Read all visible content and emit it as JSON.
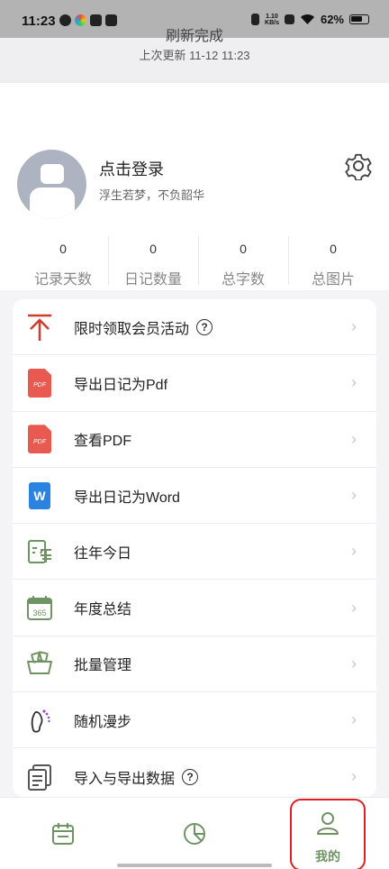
{
  "status_bar": {
    "time": "11:23",
    "speed_value": "1.10",
    "speed_unit": "KB/s",
    "battery": "62%"
  },
  "refresh": {
    "title": "刷新完成",
    "subtitle": "上次更新 11-12 11:23"
  },
  "profile": {
    "login_label": "点击登录",
    "motto": "浮生若梦，不负韶华"
  },
  "stats": [
    {
      "value": "0",
      "label": "记录天数"
    },
    {
      "value": "0",
      "label": "日记数量"
    },
    {
      "value": "0",
      "label": "总字数"
    },
    {
      "value": "0",
      "label": "总图片"
    }
  ],
  "menu": {
    "items": [
      {
        "label": "限时领取会员活动",
        "icon": "arrow-up-icon",
        "help": true
      },
      {
        "label": "导出日记为Pdf",
        "icon": "pdf-icon",
        "help": false
      },
      {
        "label": "查看PDF",
        "icon": "pdf-icon",
        "help": false
      },
      {
        "label": "导出日记为Word",
        "icon": "word-icon",
        "help": false
      },
      {
        "label": "往年今日",
        "icon": "calendar-year-icon",
        "help": false
      },
      {
        "label": "年度总结",
        "icon": "calendar-365-icon",
        "help": false
      },
      {
        "label": "批量管理",
        "icon": "basket-icon",
        "help": false
      },
      {
        "label": "随机漫步",
        "icon": "footprint-icon",
        "help": false
      },
      {
        "label": "导入与导出数据",
        "icon": "documents-icon",
        "help": true
      }
    ],
    "help_glyph": "?",
    "chevron_glyph": "›",
    "pdf_glyph": "PDF",
    "word_glyph": "W"
  },
  "bottom_nav": {
    "me_label": "我的"
  },
  "colors": {
    "accent_green": "#6f9463",
    "highlight_red": "#e02020",
    "pdf_red": "#e85a4f",
    "word_blue": "#2b83e0"
  }
}
